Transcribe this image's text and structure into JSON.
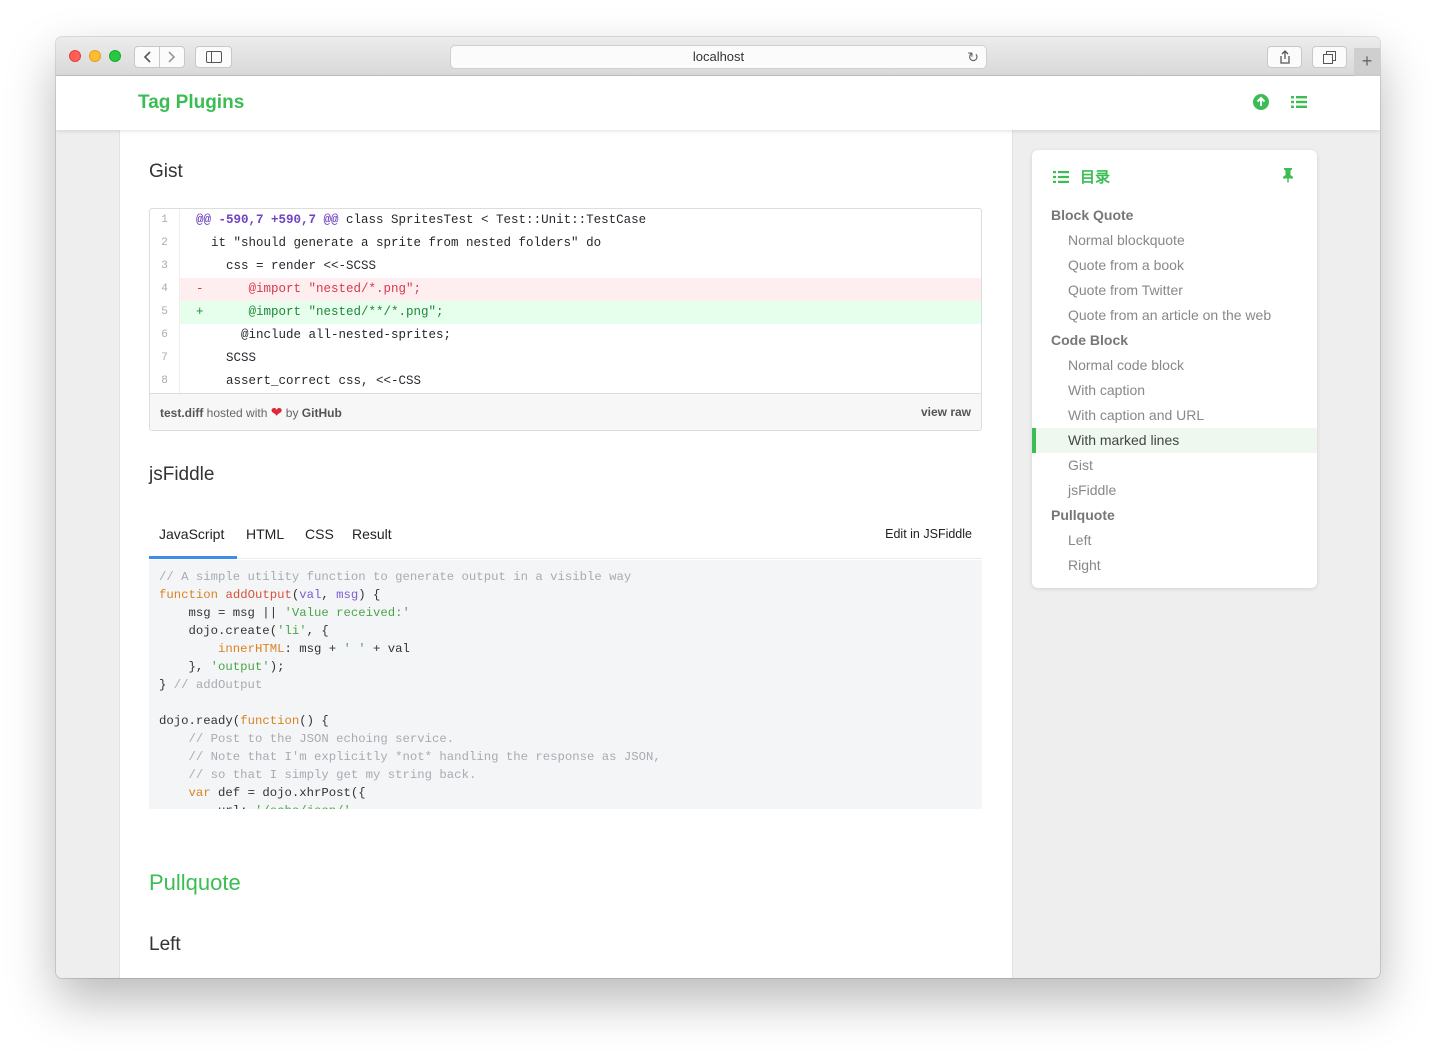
{
  "browser": {
    "url": "localhost"
  },
  "header": {
    "title": "Tag Plugins"
  },
  "main": {
    "gist_heading": "Gist",
    "gist": {
      "lines": [
        {
          "num": "1",
          "type": "hunk",
          "hunk": "@@ -590,7 +590,7 @@",
          "text": " class SpritesTest < Test::Unit::TestCase"
        },
        {
          "num": "2",
          "type": "ctx",
          "text": "  it \"should generate a sprite from nested folders\" do"
        },
        {
          "num": "3",
          "type": "ctx",
          "text": "    css = render <<-SCSS"
        },
        {
          "num": "4",
          "type": "del",
          "sign": "-",
          "text": "      @import \"nested/*.png\";"
        },
        {
          "num": "5",
          "type": "add",
          "sign": "+",
          "text": "      @import \"nested/**/*.png\";"
        },
        {
          "num": "6",
          "type": "ctx",
          "text": "      @include all-nested-sprites;"
        },
        {
          "num": "7",
          "type": "ctx",
          "text": "    SCSS"
        },
        {
          "num": "8",
          "type": "ctx",
          "text": "    assert_correct css, <<-CSS"
        }
      ],
      "meta_file": "test.diff",
      "meta_hosted": " hosted with ",
      "meta_by": " by ",
      "meta_github": "GitHub",
      "view_raw": "view raw"
    },
    "jsfiddle_heading": "jsFiddle",
    "jsfiddle": {
      "tabs": [
        "JavaScript",
        "HTML",
        "CSS",
        "Result"
      ],
      "active_tab": "JavaScript",
      "edit_link": "Edit in JSFiddle"
    },
    "pullquote_heading": "Pullquote",
    "left_heading": "Left"
  },
  "toc": {
    "title": "目录",
    "items": [
      {
        "label": "Block Quote",
        "level": 1
      },
      {
        "label": "Normal blockquote",
        "level": 2
      },
      {
        "label": "Quote from a book",
        "level": 2
      },
      {
        "label": "Quote from Twitter",
        "level": 2
      },
      {
        "label": "Quote from an article on the web",
        "level": 2
      },
      {
        "label": "Code Block",
        "level": 1
      },
      {
        "label": "Normal code block",
        "level": 2
      },
      {
        "label": "With caption",
        "level": 2
      },
      {
        "label": "With caption and URL",
        "level": 2
      },
      {
        "label": "With marked lines",
        "level": 2,
        "active": true
      },
      {
        "label": "Gist",
        "level": 2
      },
      {
        "label": "jsFiddle",
        "level": 2
      },
      {
        "label": "Pullquote",
        "level": 1
      },
      {
        "label": "Left",
        "level": 2
      },
      {
        "label": "Right",
        "level": 2
      }
    ]
  },
  "colors": {
    "accent": "#3bbd54",
    "tab_underline": "#3d8ee8"
  }
}
